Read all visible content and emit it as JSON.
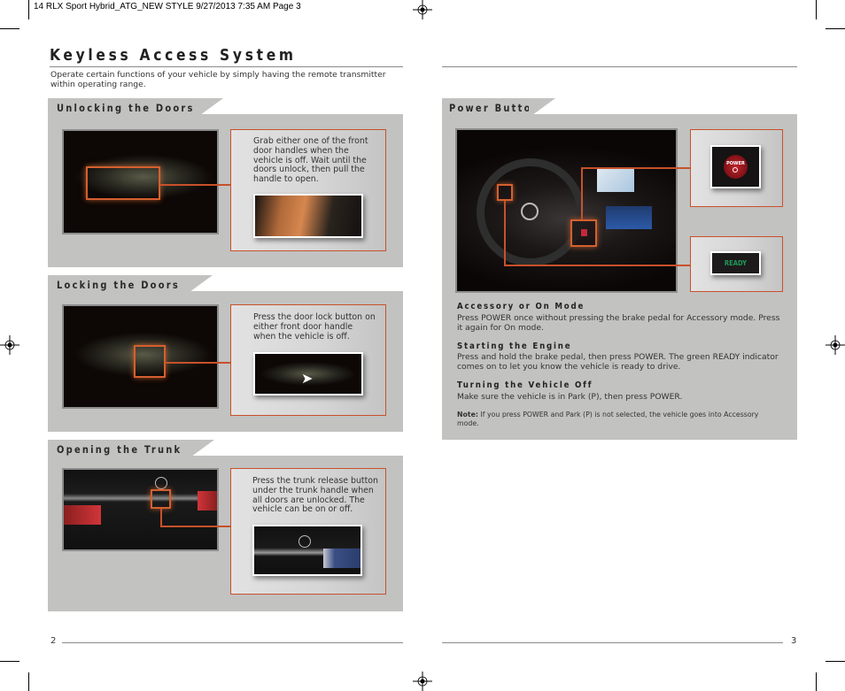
{
  "slug": "14 RLX Sport Hybrid_ATG_NEW STYLE  9/27/2013  7:35 AM  Page 3",
  "left_page": {
    "title": "Keyless Access System",
    "intro": "Operate certain functions of your vehicle by simply having the remote transmitter within operating range.",
    "sections": [
      {
        "heading": "Unlocking the Doors",
        "text": "Grab either one of the front door handles when the vehicle is off. Wait until the doors unlock, then pull the handle to open.",
        "photo": "door-handle-photo",
        "thumb": "hand-pulling-handle-photo"
      },
      {
        "heading": "Locking the Doors",
        "text": "Press the door lock button on either front door handle when the vehicle is off.",
        "photo": "door-handle-photo",
        "thumb": "lock-button-photo"
      },
      {
        "heading": "Opening the Trunk",
        "text": "Press the trunk release button under the trunk handle when all doors are unlocked. The vehicle can be on or off.",
        "photo": "trunk-photo",
        "thumb": "trunk-release-photo"
      }
    ],
    "page_number": "2"
  },
  "right_page": {
    "section_heading": "Power Button",
    "power_label": "POWER",
    "ready_label": "READY",
    "subsections": [
      {
        "heading": "Accessory or On Mode",
        "text": "Press POWER once without pressing the brake pedal for Accessory mode. Press it again for On mode."
      },
      {
        "heading": "Starting the Engine",
        "text": "Press and hold the brake pedal, then press POWER. The green READY indicator comes on to let you know the vehicle is ready to drive."
      },
      {
        "heading": "Turning the Vehicle Off",
        "text": "Make sure the vehicle is in Park (P), then press POWER."
      }
    ],
    "note_label": "Note:",
    "note_text": " If you press POWER and Park (P) is not selected, the vehicle goes into Accessory mode.",
    "page_number": "3"
  },
  "colors": {
    "accent": "#c8512a",
    "panel": "#c2c2c1",
    "ready_green": "#1f9a5a",
    "power_red": "#b01a22"
  }
}
